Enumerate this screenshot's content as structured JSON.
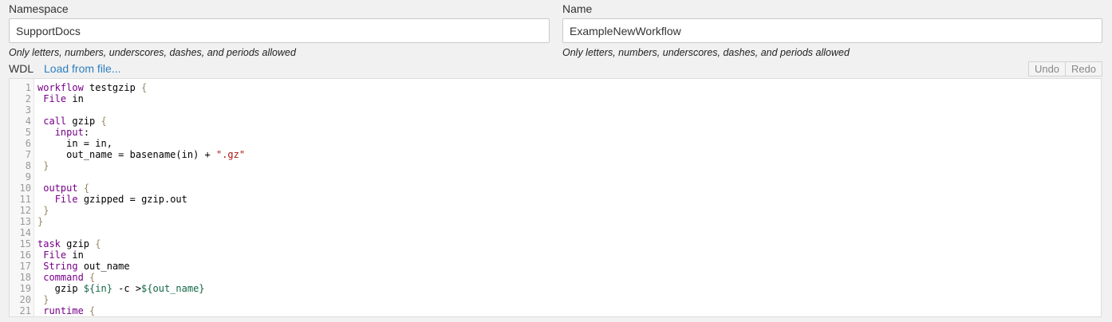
{
  "namespace": {
    "label": "Namespace",
    "value": "SupportDocs",
    "hint": "Only letters, numbers, underscores, dashes, and periods allowed"
  },
  "name": {
    "label": "Name",
    "value": "ExampleNewWorkflow",
    "hint": "Only letters, numbers, underscores, dashes, and periods allowed"
  },
  "wdl": {
    "label": "WDL",
    "load_link": "Load from file...",
    "undo_label": "Undo",
    "redo_label": "Redo",
    "lines": [
      {
        "n": "1",
        "tokens": [
          {
            "t": "workflow",
            "c": "kw"
          },
          {
            "t": " testgzip "
          },
          {
            "t": "{",
            "c": "br"
          }
        ]
      },
      {
        "n": "2",
        "tokens": [
          {
            "t": " "
          },
          {
            "t": "File",
            "c": "kw"
          },
          {
            "t": " in"
          }
        ]
      },
      {
        "n": "3",
        "tokens": []
      },
      {
        "n": "4",
        "tokens": [
          {
            "t": " "
          },
          {
            "t": "call",
            "c": "kw"
          },
          {
            "t": " gzip "
          },
          {
            "t": "{",
            "c": "br"
          }
        ]
      },
      {
        "n": "5",
        "tokens": [
          {
            "t": "   "
          },
          {
            "t": "input",
            "c": "kw"
          },
          {
            "t": ":"
          }
        ]
      },
      {
        "n": "6",
        "tokens": [
          {
            "t": "     in = in,"
          }
        ]
      },
      {
        "n": "7",
        "tokens": [
          {
            "t": "     out_name = basename(in) + "
          },
          {
            "t": "\".gz\"",
            "c": "str"
          }
        ]
      },
      {
        "n": "8",
        "tokens": [
          {
            "t": " "
          },
          {
            "t": "}",
            "c": "br"
          }
        ]
      },
      {
        "n": "9",
        "tokens": []
      },
      {
        "n": "10",
        "tokens": [
          {
            "t": " "
          },
          {
            "t": "output",
            "c": "kw"
          },
          {
            "t": " "
          },
          {
            "t": "{",
            "c": "br"
          }
        ]
      },
      {
        "n": "11",
        "tokens": [
          {
            "t": "   "
          },
          {
            "t": "File",
            "c": "kw"
          },
          {
            "t": " gzipped = gzip.out"
          }
        ]
      },
      {
        "n": "12",
        "tokens": [
          {
            "t": " "
          },
          {
            "t": "}",
            "c": "br"
          }
        ]
      },
      {
        "n": "13",
        "tokens": [
          {
            "t": "}",
            "c": "br"
          }
        ]
      },
      {
        "n": "14",
        "tokens": []
      },
      {
        "n": "15",
        "tokens": [
          {
            "t": "task",
            "c": "kw"
          },
          {
            "t": " gzip "
          },
          {
            "t": "{",
            "c": "br"
          }
        ]
      },
      {
        "n": "16",
        "tokens": [
          {
            "t": " "
          },
          {
            "t": "File",
            "c": "kw"
          },
          {
            "t": " in"
          }
        ]
      },
      {
        "n": "17",
        "tokens": [
          {
            "t": " "
          },
          {
            "t": "String",
            "c": "kw"
          },
          {
            "t": " out_name"
          }
        ]
      },
      {
        "n": "18",
        "tokens": [
          {
            "t": " "
          },
          {
            "t": "command",
            "c": "kw"
          },
          {
            "t": " "
          },
          {
            "t": "{",
            "c": "br"
          }
        ]
      },
      {
        "n": "19",
        "tokens": [
          {
            "t": "   gzip "
          },
          {
            "t": "${in}",
            "c": "itp"
          },
          {
            "t": " -c >"
          },
          {
            "t": "${out_name}",
            "c": "itp"
          }
        ]
      },
      {
        "n": "20",
        "tokens": [
          {
            "t": " "
          },
          {
            "t": "}",
            "c": "br"
          }
        ]
      },
      {
        "n": "21",
        "tokens": [
          {
            "t": " "
          },
          {
            "t": "runtime",
            "c": "kw"
          },
          {
            "t": " "
          },
          {
            "t": "{",
            "c": "br"
          }
        ]
      }
    ]
  },
  "colors": {
    "background": "#f1f1f1",
    "link": "#2d7fc0",
    "keyword": "#770088",
    "bracket": "#998866",
    "string": "#aa1111",
    "interpolation": "#116644"
  }
}
